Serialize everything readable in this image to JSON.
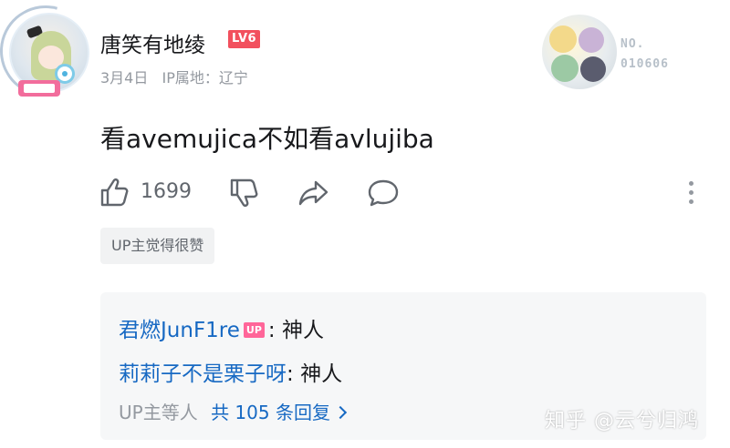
{
  "comment": {
    "username": "唐笑有地绫",
    "level": "LV6",
    "date": "3月4日",
    "ip_location": "IP属地：辽宁",
    "fan_badge": {
      "line1": "NO.",
      "line2": "010606"
    },
    "text": "看avemujica不如看avlujiba",
    "actions": {
      "like_count": "1699",
      "like_icon": "thumbs-up-icon",
      "dislike_icon": "thumbs-down-icon",
      "share_icon": "share-icon",
      "reply_icon": "reply-icon",
      "more_icon": "more-vertical-icon"
    },
    "up_liked_tag": "UP主觉得很赞"
  },
  "replies": {
    "items": [
      {
        "user": "君燃JunF1re",
        "tag": "UP",
        "separator": ":",
        "text": "神人"
      },
      {
        "user": "莉莉子不是栗子呀",
        "separator": ":",
        "text": "神人"
      }
    ],
    "summary_prefix": "UP主等人",
    "summary_link": "共 105 条回复"
  },
  "watermark": "知乎 @云兮归鸿",
  "colors": {
    "accent_blue": "#1769c3",
    "level_red": "#f2505e",
    "up_pink": "#ff6699",
    "muted_gray": "#9499a0"
  }
}
